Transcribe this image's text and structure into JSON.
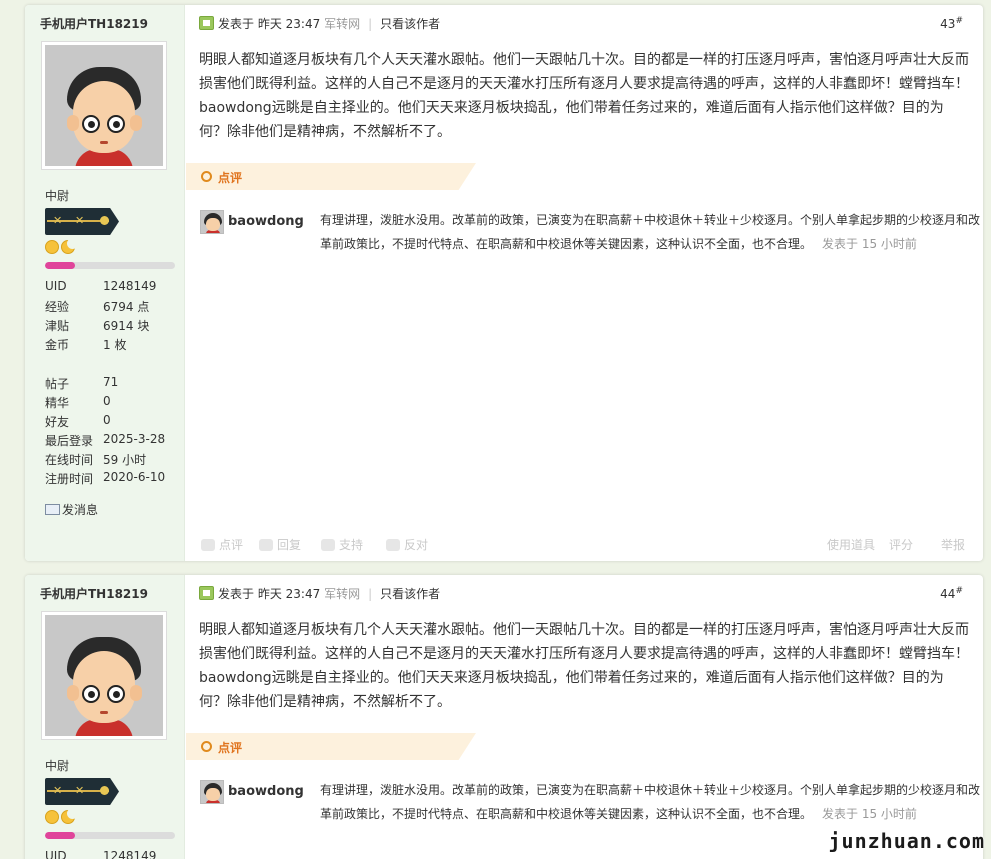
{
  "posts": [
    {
      "user": {
        "name": "手机用户TH18219",
        "rank": "中尉",
        "stats": [
          {
            "k": "UID",
            "v": "1248149"
          },
          {
            "k": "经验",
            "v": "6794 点"
          },
          {
            "k": "津贴",
            "v": "6914 块"
          },
          {
            "k": "金币",
            "v": "1 枚"
          },
          {
            "k": "帖子",
            "v": "71"
          },
          {
            "k": "精华",
            "v": "0"
          },
          {
            "k": "好友",
            "v": "0"
          },
          {
            "k": "最后登录",
            "v": "2025-3-28"
          },
          {
            "k": "在线时间",
            "v": "59 小时"
          },
          {
            "k": "注册时间",
            "v": "2020-6-10"
          }
        ],
        "send_message": "发消息",
        "level_progress": 0.23
      },
      "meta": {
        "posted_prefix": "发表于",
        "posted_time": "昨天 23:47",
        "source": "军转网",
        "only_author": "只看该作者",
        "floor": "43",
        "floor_mark": "#"
      },
      "content": "明眼人都知道逐月板块有几个人天天灌水跟帖。他们一天跟帖几十次。目的都是一样的打压逐月呼声，害怕逐月呼声壮大反而损害他们既得利益。这样的人自己不是逐月的天天灌水打压所有逐月人要求提高待遇的呼声，这样的人非蠢即坏！螳臂挡车！baowdong远眺是自主择业的。他们天天来逐月板块捣乱，他们带着任务过来的，难道后面有人指示他们这样做？目的为何？除非他们是精神病，不然解析不了。",
      "review_label": "点评",
      "comment": {
        "user": "baowdong",
        "text": "有理讲理，泼脏水没用。改革前的政策，已演变为在职高薪＋中校退休＋转业＋少校逐月。个别人单拿起步期的少校逐月和改革前政策比，不提时代特点、在职高薪和中校退休等关键因素，这种认识不全面，也不合理。",
        "time": "发表于 15 小时前"
      },
      "actions": {
        "review": "点评",
        "reply": "回复",
        "support": "支持",
        "oppose": "反对",
        "use_tool": "使用道具",
        "rate": "评分",
        "report": "举报"
      }
    },
    {
      "user": {
        "name": "手机用户TH18219",
        "rank": "中尉",
        "stats": [
          {
            "k": "UID",
            "v": "1248149"
          }
        ],
        "level_progress": 0.23
      },
      "meta": {
        "posted_prefix": "发表于",
        "posted_time": "昨天 23:47",
        "source": "军转网",
        "only_author": "只看该作者",
        "floor": "44",
        "floor_mark": "#"
      },
      "content": "明眼人都知道逐月板块有几个人天天灌水跟帖。他们一天跟帖几十次。目的都是一样的打压逐月呼声，害怕逐月呼声壮大反而损害他们既得利益。这样的人自己不是逐月的天天灌水打压所有逐月人要求提高待遇的呼声，这样的人非蠢即坏！螳臂挡车！baowdong远眺是自主择业的。他们天天来逐月板块捣乱，他们带着任务过来的，难道后面有人指示他们这样做？目的为何？除非他们是精神病，不然解析不了。",
      "review_label": "点评",
      "comment": {
        "user": "baowdong",
        "text": "有理讲理，泼脏水没用。改革前的政策，已演变为在职高薪＋中校退休＋转业＋少校逐月。个别人单拿起步期的少校逐月和改革前政策比，不提时代特点、在职高薪和中校退休等关键因素，这种认识不全面，也不合理。",
        "time": "发表于 15 小时前"
      }
    }
  ],
  "watermark": "junzhuan.com",
  "colors": {
    "page_bg": "#eef3e6",
    "sidebar_bg": "#eef6ec",
    "review_accent": "#e0741e",
    "level_bar": "#e0449a"
  }
}
